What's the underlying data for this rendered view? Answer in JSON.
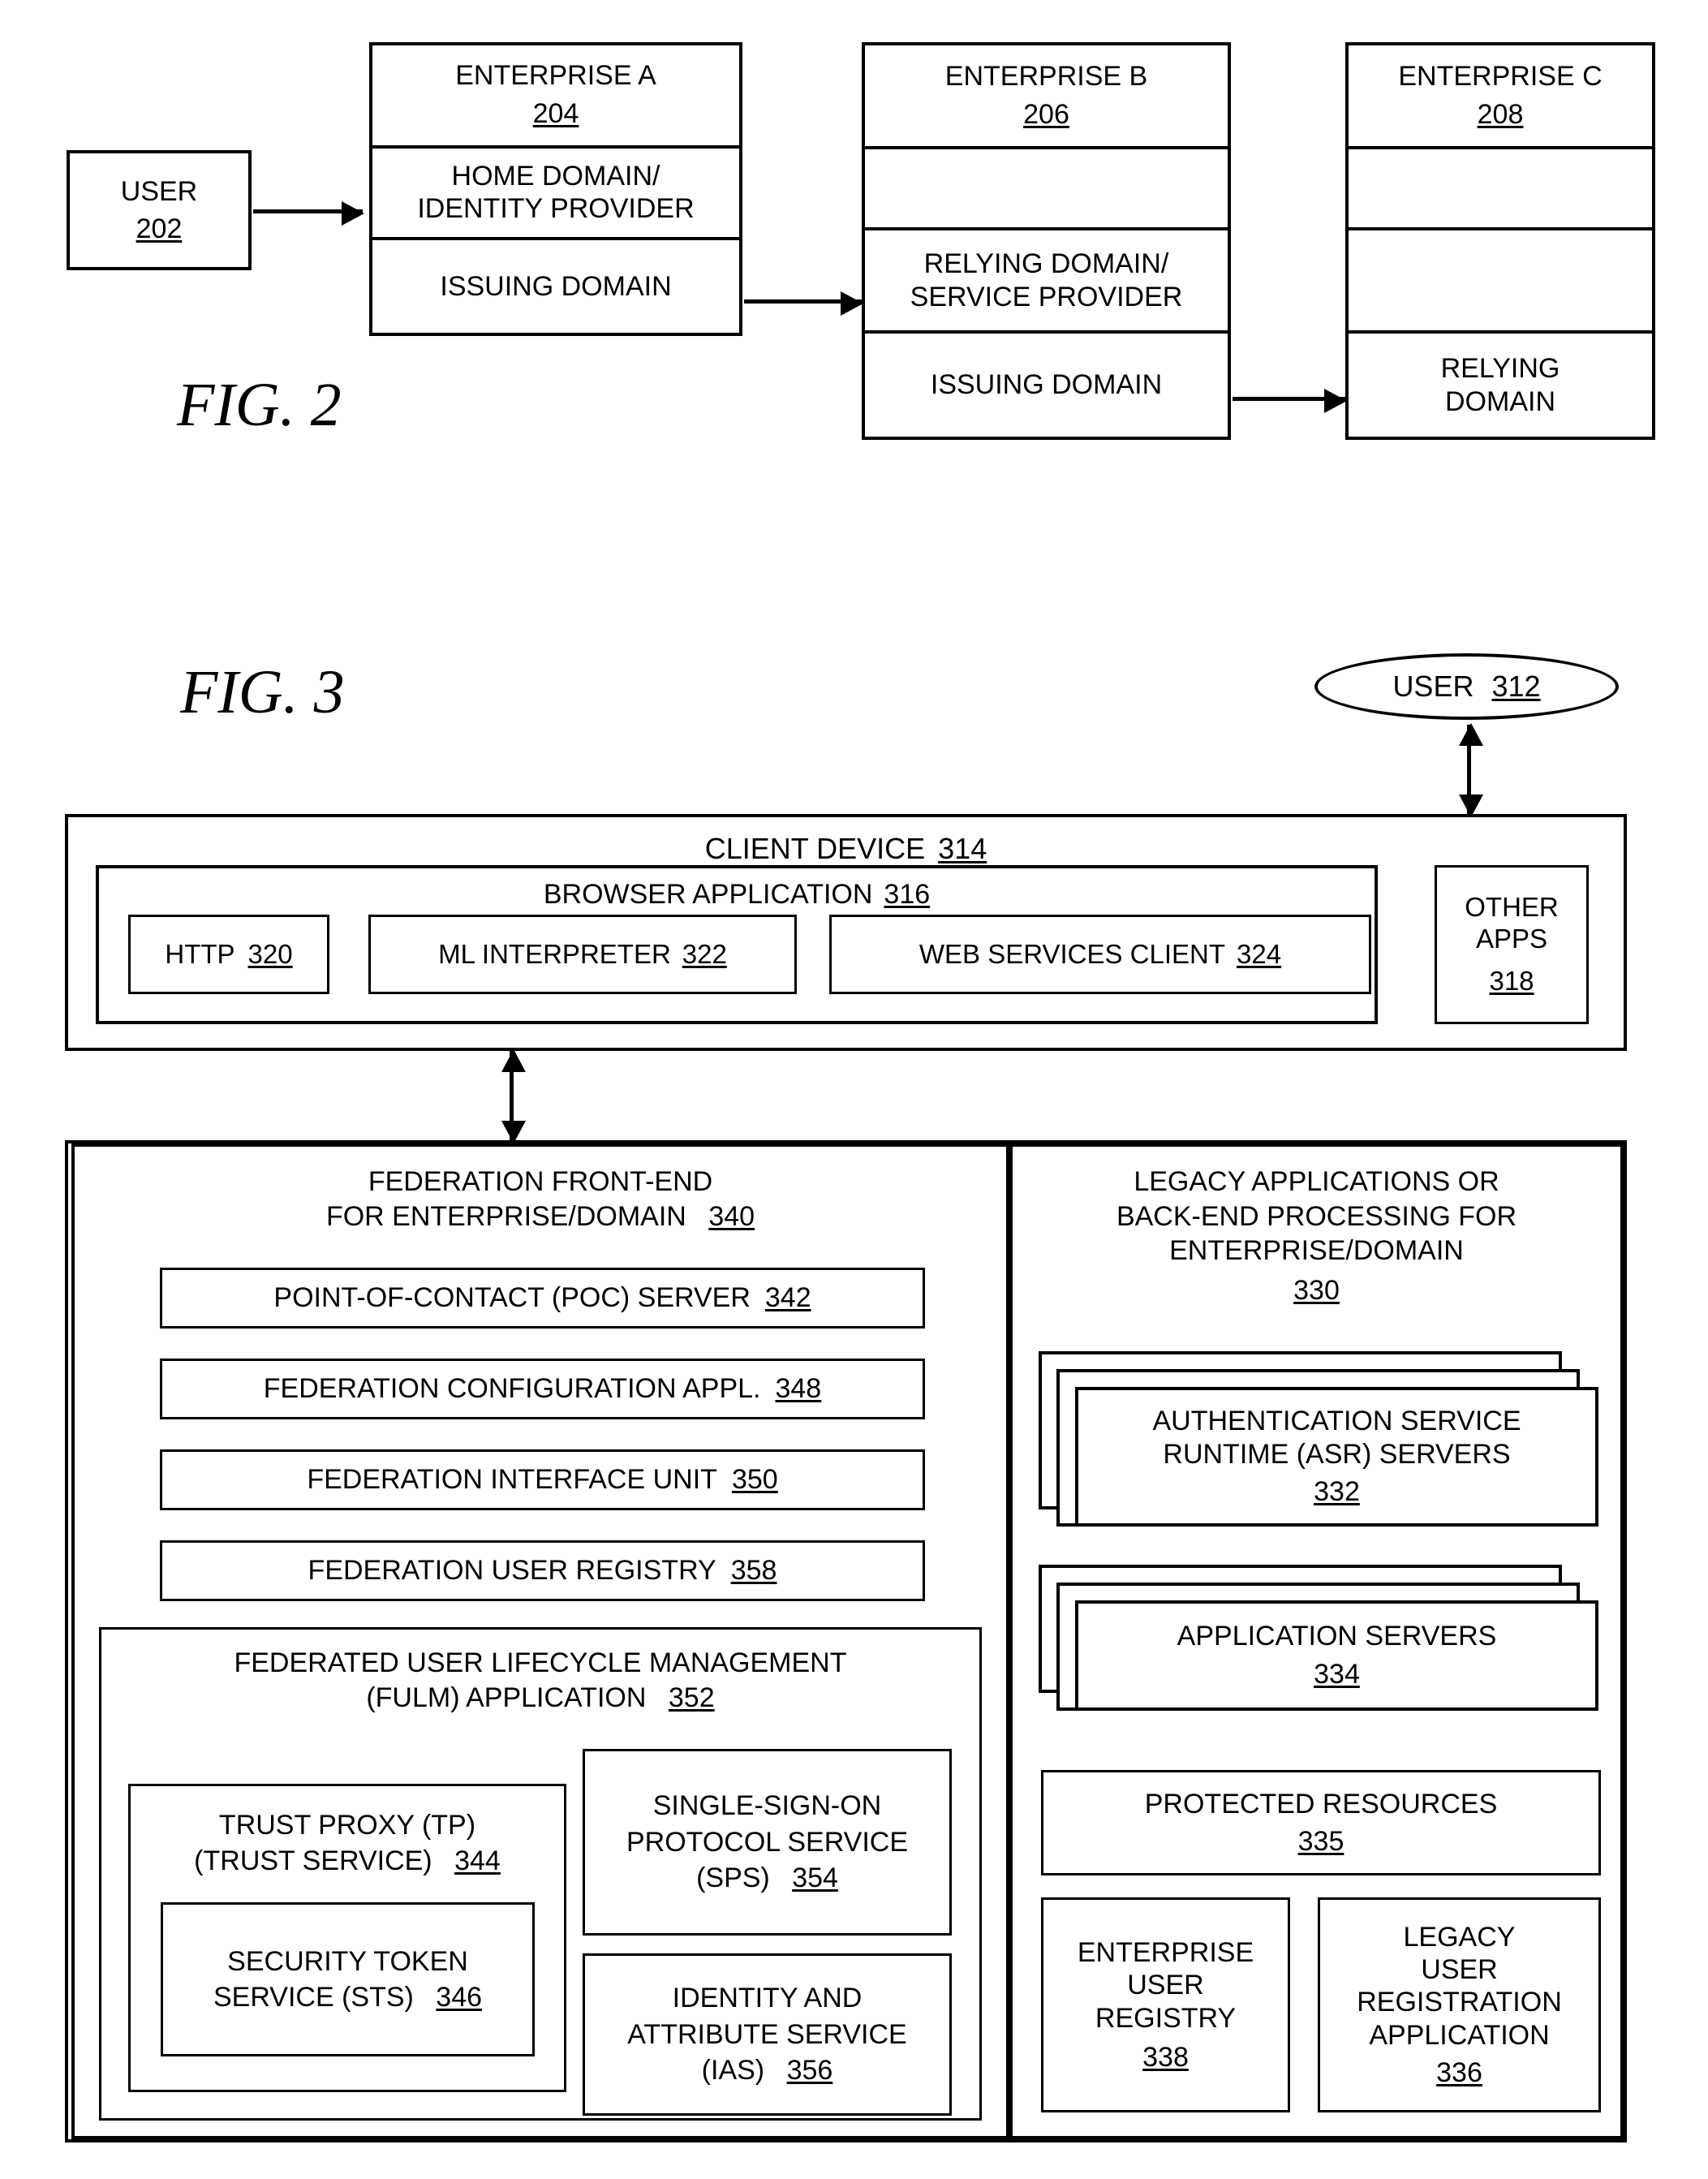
{
  "figures": {
    "fig2": {
      "label": "FIG. 2",
      "user": {
        "title": "USER",
        "number": "202"
      },
      "enterprises": [
        {
          "name": "ENTERPRISE A",
          "number": "204",
          "rows": [
            "HOME DOMAIN/\nIDENTITY PROVIDER",
            "ISSUING DOMAIN"
          ]
        },
        {
          "name": "ENTERPRISE B",
          "number": "206",
          "rows": [
            "",
            "RELYING DOMAIN/\nSERVICE PROVIDER",
            "ISSUING DOMAIN"
          ]
        },
        {
          "name": "ENTERPRISE C",
          "number": "208",
          "rows": [
            "",
            "",
            "RELYING\nDOMAIN"
          ]
        }
      ]
    },
    "fig3": {
      "label": "FIG. 3",
      "user": {
        "title": "USER",
        "number": "312"
      },
      "client_device": {
        "title": "CLIENT DEVICE",
        "number": "314",
        "browser": {
          "title": "BROWSER APPLICATION",
          "number": "316",
          "components": [
            {
              "title": "HTTP",
              "number": "320"
            },
            {
              "title": "ML INTERPRETER",
              "number": "322"
            },
            {
              "title": "WEB SERVICES CLIENT",
              "number": "324"
            }
          ]
        },
        "other_apps": {
          "title": "OTHER\nAPPS",
          "number": "318"
        }
      },
      "federation_front_end": {
        "title": "FEDERATION FRONT-END\nFOR ENTERPRISE/DOMAIN",
        "number": "340",
        "components": [
          {
            "title": "POINT-OF-CONTACT (POC) SERVER",
            "number": "342"
          },
          {
            "title": "FEDERATION CONFIGURATION APPL.",
            "number": "348"
          },
          {
            "title": "FEDERATION INTERFACE UNIT",
            "number": "350"
          },
          {
            "title": "FEDERATION USER REGISTRY",
            "number": "358"
          }
        ],
        "fulm": {
          "title": "FEDERATED USER LIFECYCLE MANAGEMENT\n(FULM) APPLICATION",
          "number": "352",
          "trust_proxy": {
            "title": "TRUST PROXY (TP)\n(TRUST SERVICE)",
            "number": "344",
            "sts": {
              "title": "SECURITY TOKEN\nSERVICE (STS)",
              "number": "346"
            }
          },
          "sps": {
            "title": "SINGLE-SIGN-ON\nPROTOCOL SERVICE\n(SPS)",
            "number": "354"
          },
          "ias": {
            "title": "IDENTITY AND\nATTRIBUTE SERVICE\n(IAS)",
            "number": "356"
          }
        }
      },
      "legacy": {
        "title": "LEGACY APPLICATIONS OR\nBACK-END PROCESSING FOR\nENTERPRISE/DOMAIN",
        "number": "330",
        "asr": {
          "title": "AUTHENTICATION SERVICE\nRUNTIME (ASR) SERVERS",
          "number": "332"
        },
        "app_servers": {
          "title": "APPLICATION SERVERS",
          "number": "334"
        },
        "protected_resources": {
          "title": "PROTECTED RESOURCES",
          "number": "335"
        },
        "enterprise_user_registry": {
          "title": "ENTERPRISE\nUSER\nREGISTRY",
          "number": "338"
        },
        "legacy_user_registration": {
          "title": "LEGACY\nUSER\nREGISTRATION\nAPPLICATION",
          "number": "336"
        }
      }
    }
  },
  "colors": {
    "ink": "#000000",
    "paper": "#ffffff"
  }
}
